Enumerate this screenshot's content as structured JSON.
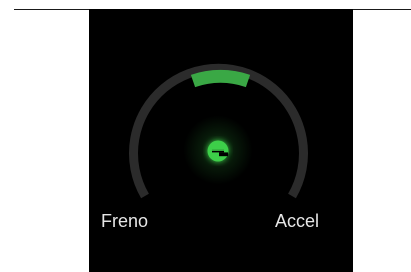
{
  "gauge": {
    "brake_label": "Freno",
    "accel_label": "Accel",
    "mode_icon": "eco-e-icon",
    "level_fraction": 0.5,
    "colors": {
      "track": "#2b2b2b",
      "indicator": "#3aa845",
      "icon": "#3ecf4a",
      "label": "#e6e6e6",
      "background": "#000000"
    }
  }
}
